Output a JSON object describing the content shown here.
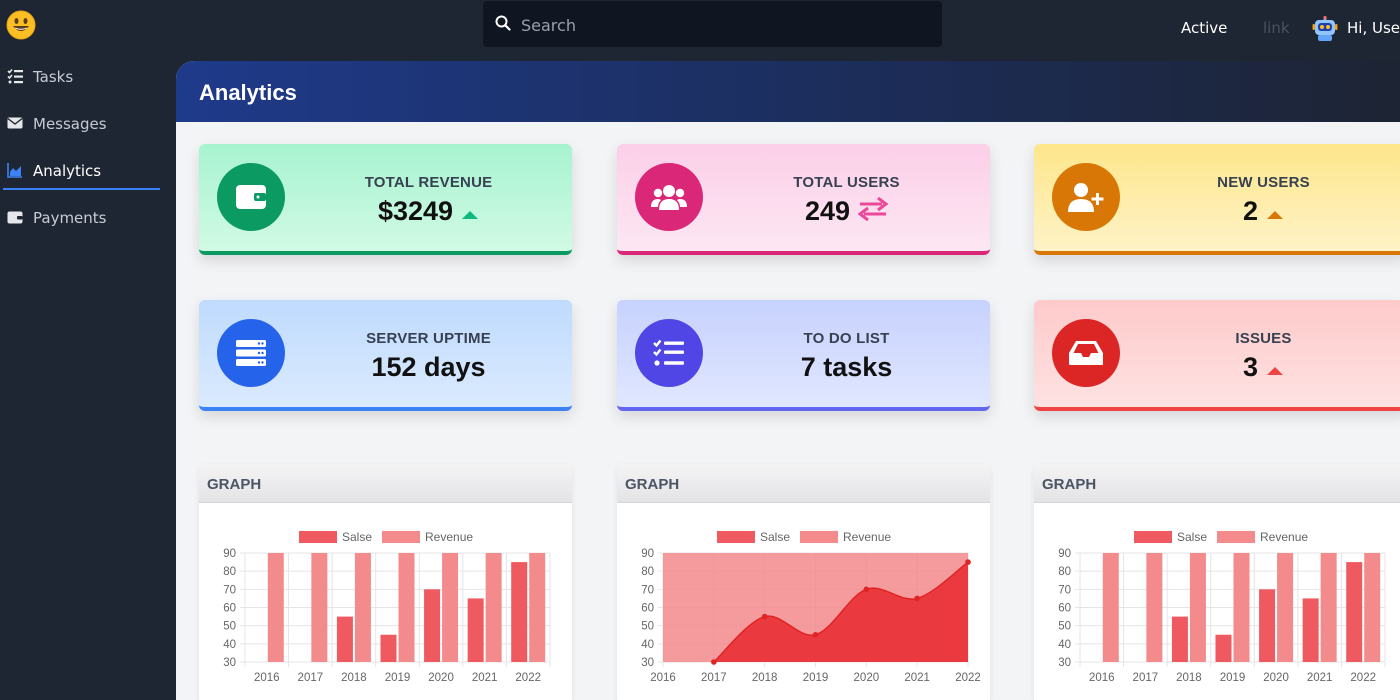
{
  "topbar": {
    "search_placeholder": "Search",
    "nav_active": "Active",
    "nav_link": "link",
    "greeting": "Hi, User"
  },
  "sidebar": {
    "items": [
      {
        "label": "Tasks",
        "icon": "tasks-icon"
      },
      {
        "label": "Messages",
        "icon": "envelope-icon"
      },
      {
        "label": "Analytics",
        "icon": "chart-area-icon"
      },
      {
        "label": "Payments",
        "icon": "wallet-icon"
      }
    ],
    "active_index": 2
  },
  "main": {
    "title": "Analytics",
    "cards": [
      {
        "label": "TOTAL REVENUE",
        "value": "$3249",
        "icon": "wallet-icon",
        "trend": "up",
        "color": "#0a9a62"
      },
      {
        "label": "TOTAL USERS",
        "value": "249",
        "icon": "users-icon",
        "trend": "exchange",
        "color": "#db2777"
      },
      {
        "label": "NEW USERS",
        "value": "2",
        "icon": "user-plus-icon",
        "trend": "up",
        "color": "#d97706"
      },
      {
        "label": "SERVER UPTIME",
        "value": "152 days",
        "icon": "server-icon",
        "trend": "none",
        "color": "#2563eb"
      },
      {
        "label": "TO DO LIST",
        "value": "7 tasks",
        "icon": "tasks-icon",
        "trend": "none",
        "color": "#4f46e5"
      },
      {
        "label": "ISSUES",
        "value": "3",
        "icon": "inbox-icon",
        "trend": "up",
        "color": "#dc2626"
      }
    ],
    "graph_titles": [
      "GRAPH",
      "GRAPH",
      "GRAPH"
    ]
  },
  "chart_data": [
    {
      "type": "bar",
      "categories": [
        "2016",
        "2017",
        "2018",
        "2019",
        "2020",
        "2021",
        "2022"
      ],
      "series": [
        {
          "name": "Salse",
          "values": [
            0,
            0,
            55,
            45,
            70,
            65,
            85
          ],
          "color": "#ee5a5f"
        },
        {
          "name": "Revenue",
          "values": [
            90,
            90,
            90,
            90,
            90,
            90,
            90
          ],
          "color": "#f38a8c"
        }
      ],
      "ylim": [
        30,
        90
      ],
      "yticks": [
        30,
        40,
        50,
        60,
        70,
        80,
        90
      ],
      "grid": true,
      "legend": "top"
    },
    {
      "type": "area",
      "categories": [
        "2016",
        "2017",
        "2018",
        "2019",
        "2020",
        "2021",
        "2022"
      ],
      "series": [
        {
          "name": "Salse",
          "values": [
            null,
            30,
            55,
            45,
            70,
            65,
            85
          ],
          "color": "#ee5a5f"
        },
        {
          "name": "Revenue",
          "values": [
            90,
            90,
            90,
            90,
            90,
            90,
            90
          ],
          "color": "#f38a8c"
        }
      ],
      "ylim": [
        30,
        90
      ],
      "yticks": [
        30,
        40,
        50,
        60,
        70,
        80,
        90
      ],
      "grid": true,
      "legend": "top"
    },
    {
      "type": "bar",
      "categories": [
        "2016",
        "2017",
        "2018",
        "2019",
        "2020",
        "2021",
        "2022"
      ],
      "series": [
        {
          "name": "Salse",
          "values": [
            0,
            0,
            55,
            45,
            70,
            65,
            85
          ],
          "color": "#ee5a5f"
        },
        {
          "name": "Revenue",
          "values": [
            90,
            90,
            90,
            90,
            90,
            90,
            90
          ],
          "color": "#f38a8c"
        }
      ],
      "ylim": [
        30,
        90
      ],
      "yticks": [
        30,
        40,
        50,
        60,
        70,
        80,
        90
      ],
      "grid": true,
      "legend": "top"
    }
  ]
}
